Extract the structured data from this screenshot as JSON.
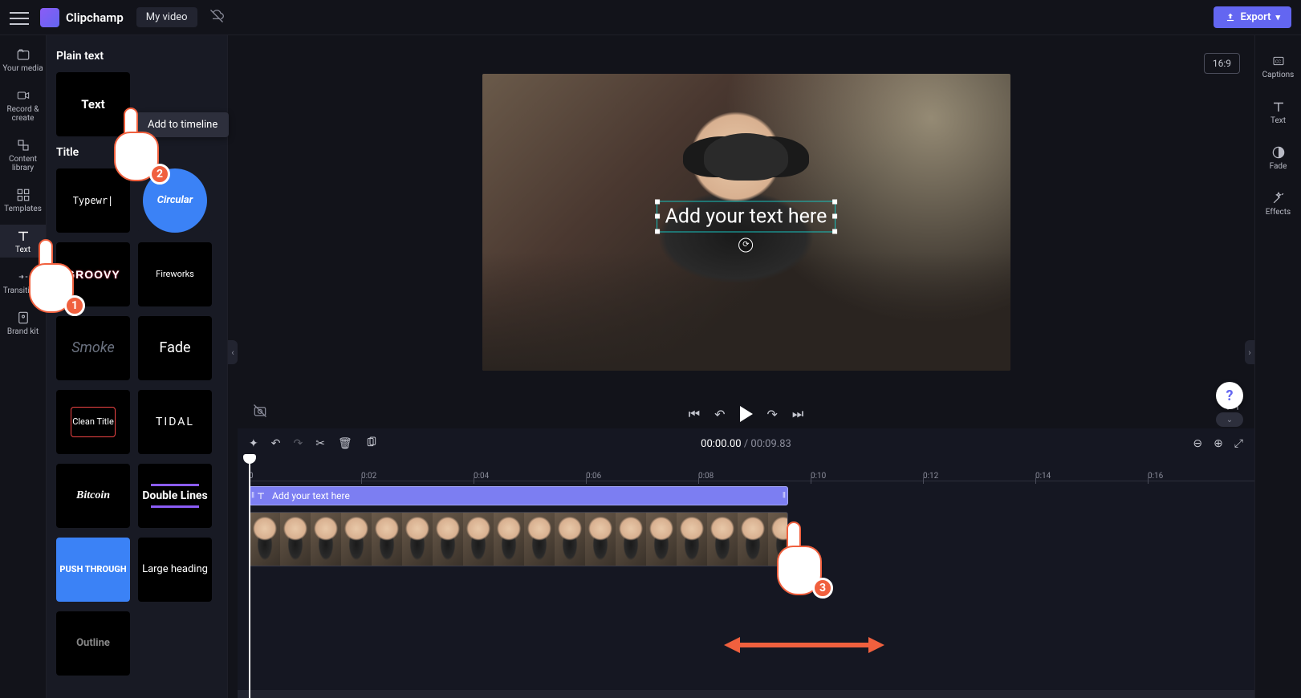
{
  "topbar": {
    "brand": "Clipchamp",
    "title": "My video",
    "export": "Export"
  },
  "leftrail": {
    "items": [
      {
        "label": "Your media"
      },
      {
        "label": "Record & create"
      },
      {
        "label": "Content library"
      },
      {
        "label": "Templates"
      },
      {
        "label": "Text"
      },
      {
        "label": "Transitions"
      },
      {
        "label": "Brand kit"
      }
    ]
  },
  "textpanel": {
    "plain_section": "Plain text",
    "plain_tile": "Text",
    "title_section": "Title",
    "tiles": {
      "typewriter": "Typewr|",
      "circular": "Circular",
      "groovy": "GROOVY",
      "fireworks": "Fireworks",
      "smoke": "Smoke",
      "fade": "Fade",
      "clean": "Clean Title",
      "tidal": "TIDAL",
      "bitcoin": "Bitcoin",
      "double": "Double Lines",
      "push": "PUSH THROUGH",
      "large": "Large heading",
      "outline": "Outline"
    }
  },
  "tooltip": "Add to timeline",
  "canvas": {
    "overlay_text": "Add your text here",
    "aspect": "16:9"
  },
  "rightrail": {
    "captions": "Captions",
    "text": "Text",
    "fade": "Fade",
    "effects": "Effects"
  },
  "timeline": {
    "current": "00:00.00",
    "duration": "00:09.83",
    "ticks": [
      "0",
      "0:02",
      "0:04",
      "0:06",
      "0:08",
      "0:10",
      "0:12",
      "0:14",
      "0:16"
    ],
    "text_clip_label": "Add your text here"
  },
  "steps": {
    "one": "1",
    "two": "2",
    "three": "3"
  },
  "help": "?"
}
